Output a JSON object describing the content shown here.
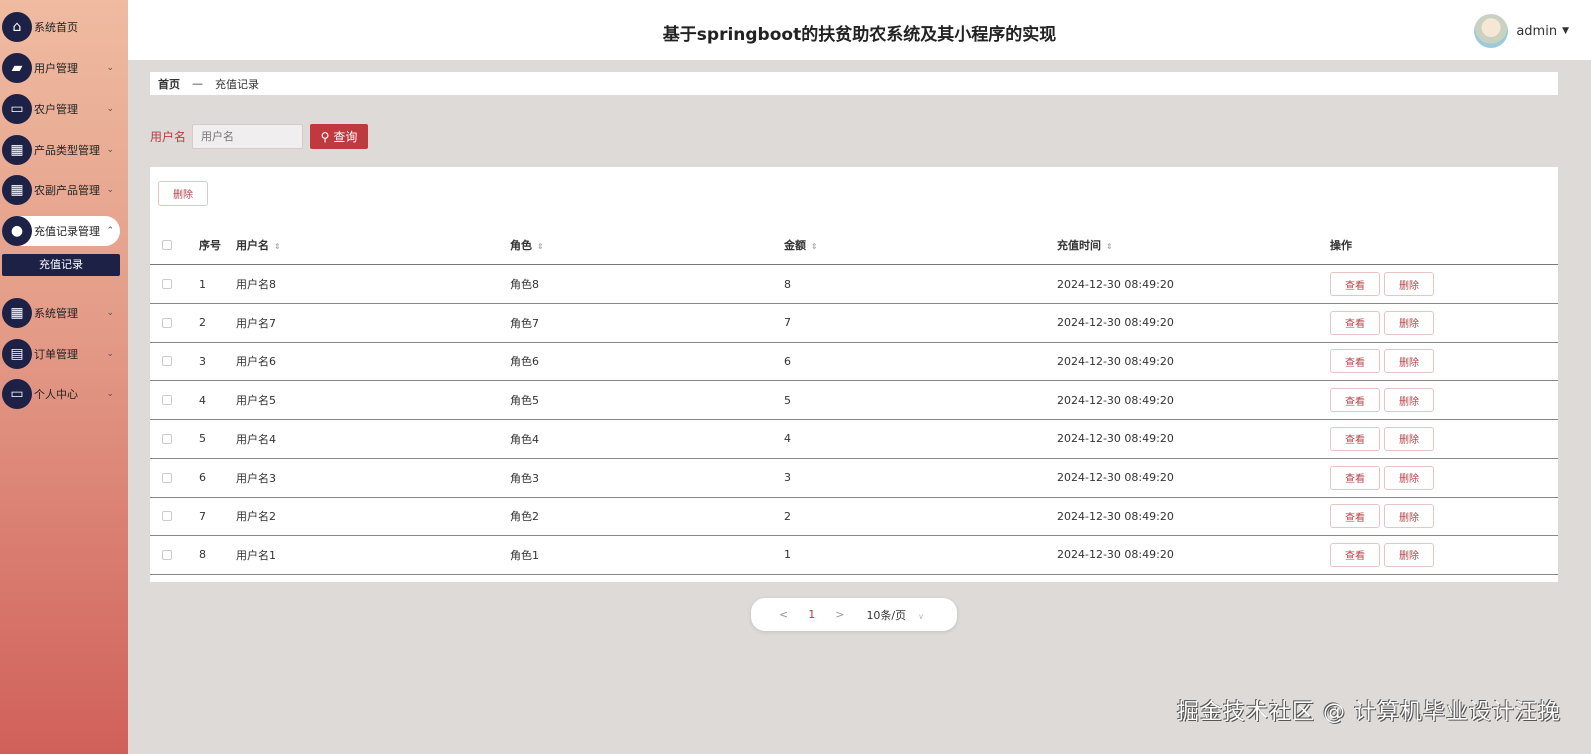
{
  "app": {
    "title": "基于springboot的扶贫助农系统及其小程序的实现",
    "user": "admin"
  },
  "sidebar": {
    "items": [
      {
        "label": "系统首页",
        "icon": "home-icon",
        "glyph": "⌂",
        "chevron": ""
      },
      {
        "label": "用户管理",
        "icon": "wallet-icon",
        "glyph": "▰",
        "chevron": "⌄"
      },
      {
        "label": "农户管理",
        "icon": "monitor-icon",
        "glyph": "▭",
        "chevron": "⌄"
      },
      {
        "label": "产品类型管理",
        "icon": "grid-icon",
        "glyph": "▦",
        "chevron": "⌄"
      },
      {
        "label": "农副产品管理",
        "icon": "grid-icon",
        "glyph": "▦",
        "chevron": "⌄"
      },
      {
        "label": "充值记录管理",
        "icon": "user-icon",
        "glyph": "●",
        "chevron": "⌃"
      },
      {
        "label": "系统管理",
        "icon": "grid-icon",
        "glyph": "▦",
        "chevron": "⌄"
      },
      {
        "label": "订单管理",
        "icon": "clipboard-icon",
        "glyph": "▤",
        "chevron": "⌄"
      },
      {
        "label": "个人中心",
        "icon": "card-icon",
        "glyph": "▭",
        "chevron": "⌄"
      }
    ],
    "subitem": "充值记录"
  },
  "breadcrumb": {
    "home": "首页",
    "sep": "—",
    "current": "充值记录"
  },
  "search": {
    "label": "用户名",
    "placeholder": "用户名",
    "button": "查询"
  },
  "toolbar": {
    "delete": "删除"
  },
  "table": {
    "headers": [
      "序号",
      "用户名",
      "角色",
      "金额",
      "充值时间",
      "操作"
    ],
    "rows": [
      [
        "1",
        "用户名8",
        "角色8",
        "8",
        "2024-12-30 08:49:20"
      ],
      [
        "2",
        "用户名7",
        "角色7",
        "7",
        "2024-12-30 08:49:20"
      ],
      [
        "3",
        "用户名6",
        "角色6",
        "6",
        "2024-12-30 08:49:20"
      ],
      [
        "4",
        "用户名5",
        "角色5",
        "5",
        "2024-12-30 08:49:20"
      ],
      [
        "5",
        "用户名4",
        "角色4",
        "4",
        "2024-12-30 08:49:20"
      ],
      [
        "6",
        "用户名3",
        "角色3",
        "3",
        "2024-12-30 08:49:20"
      ],
      [
        "7",
        "用户名2",
        "角色2",
        "2",
        "2024-12-30 08:49:20"
      ],
      [
        "8",
        "用户名1",
        "角色1",
        "1",
        "2024-12-30 08:49:20"
      ]
    ],
    "view": "查看",
    "del": "删除"
  },
  "pager": {
    "prev": "<",
    "page": "1",
    "next": ">",
    "size": "10条/页"
  },
  "watermark": "掘金技术社区 @ 计算机毕业设计汪挽"
}
